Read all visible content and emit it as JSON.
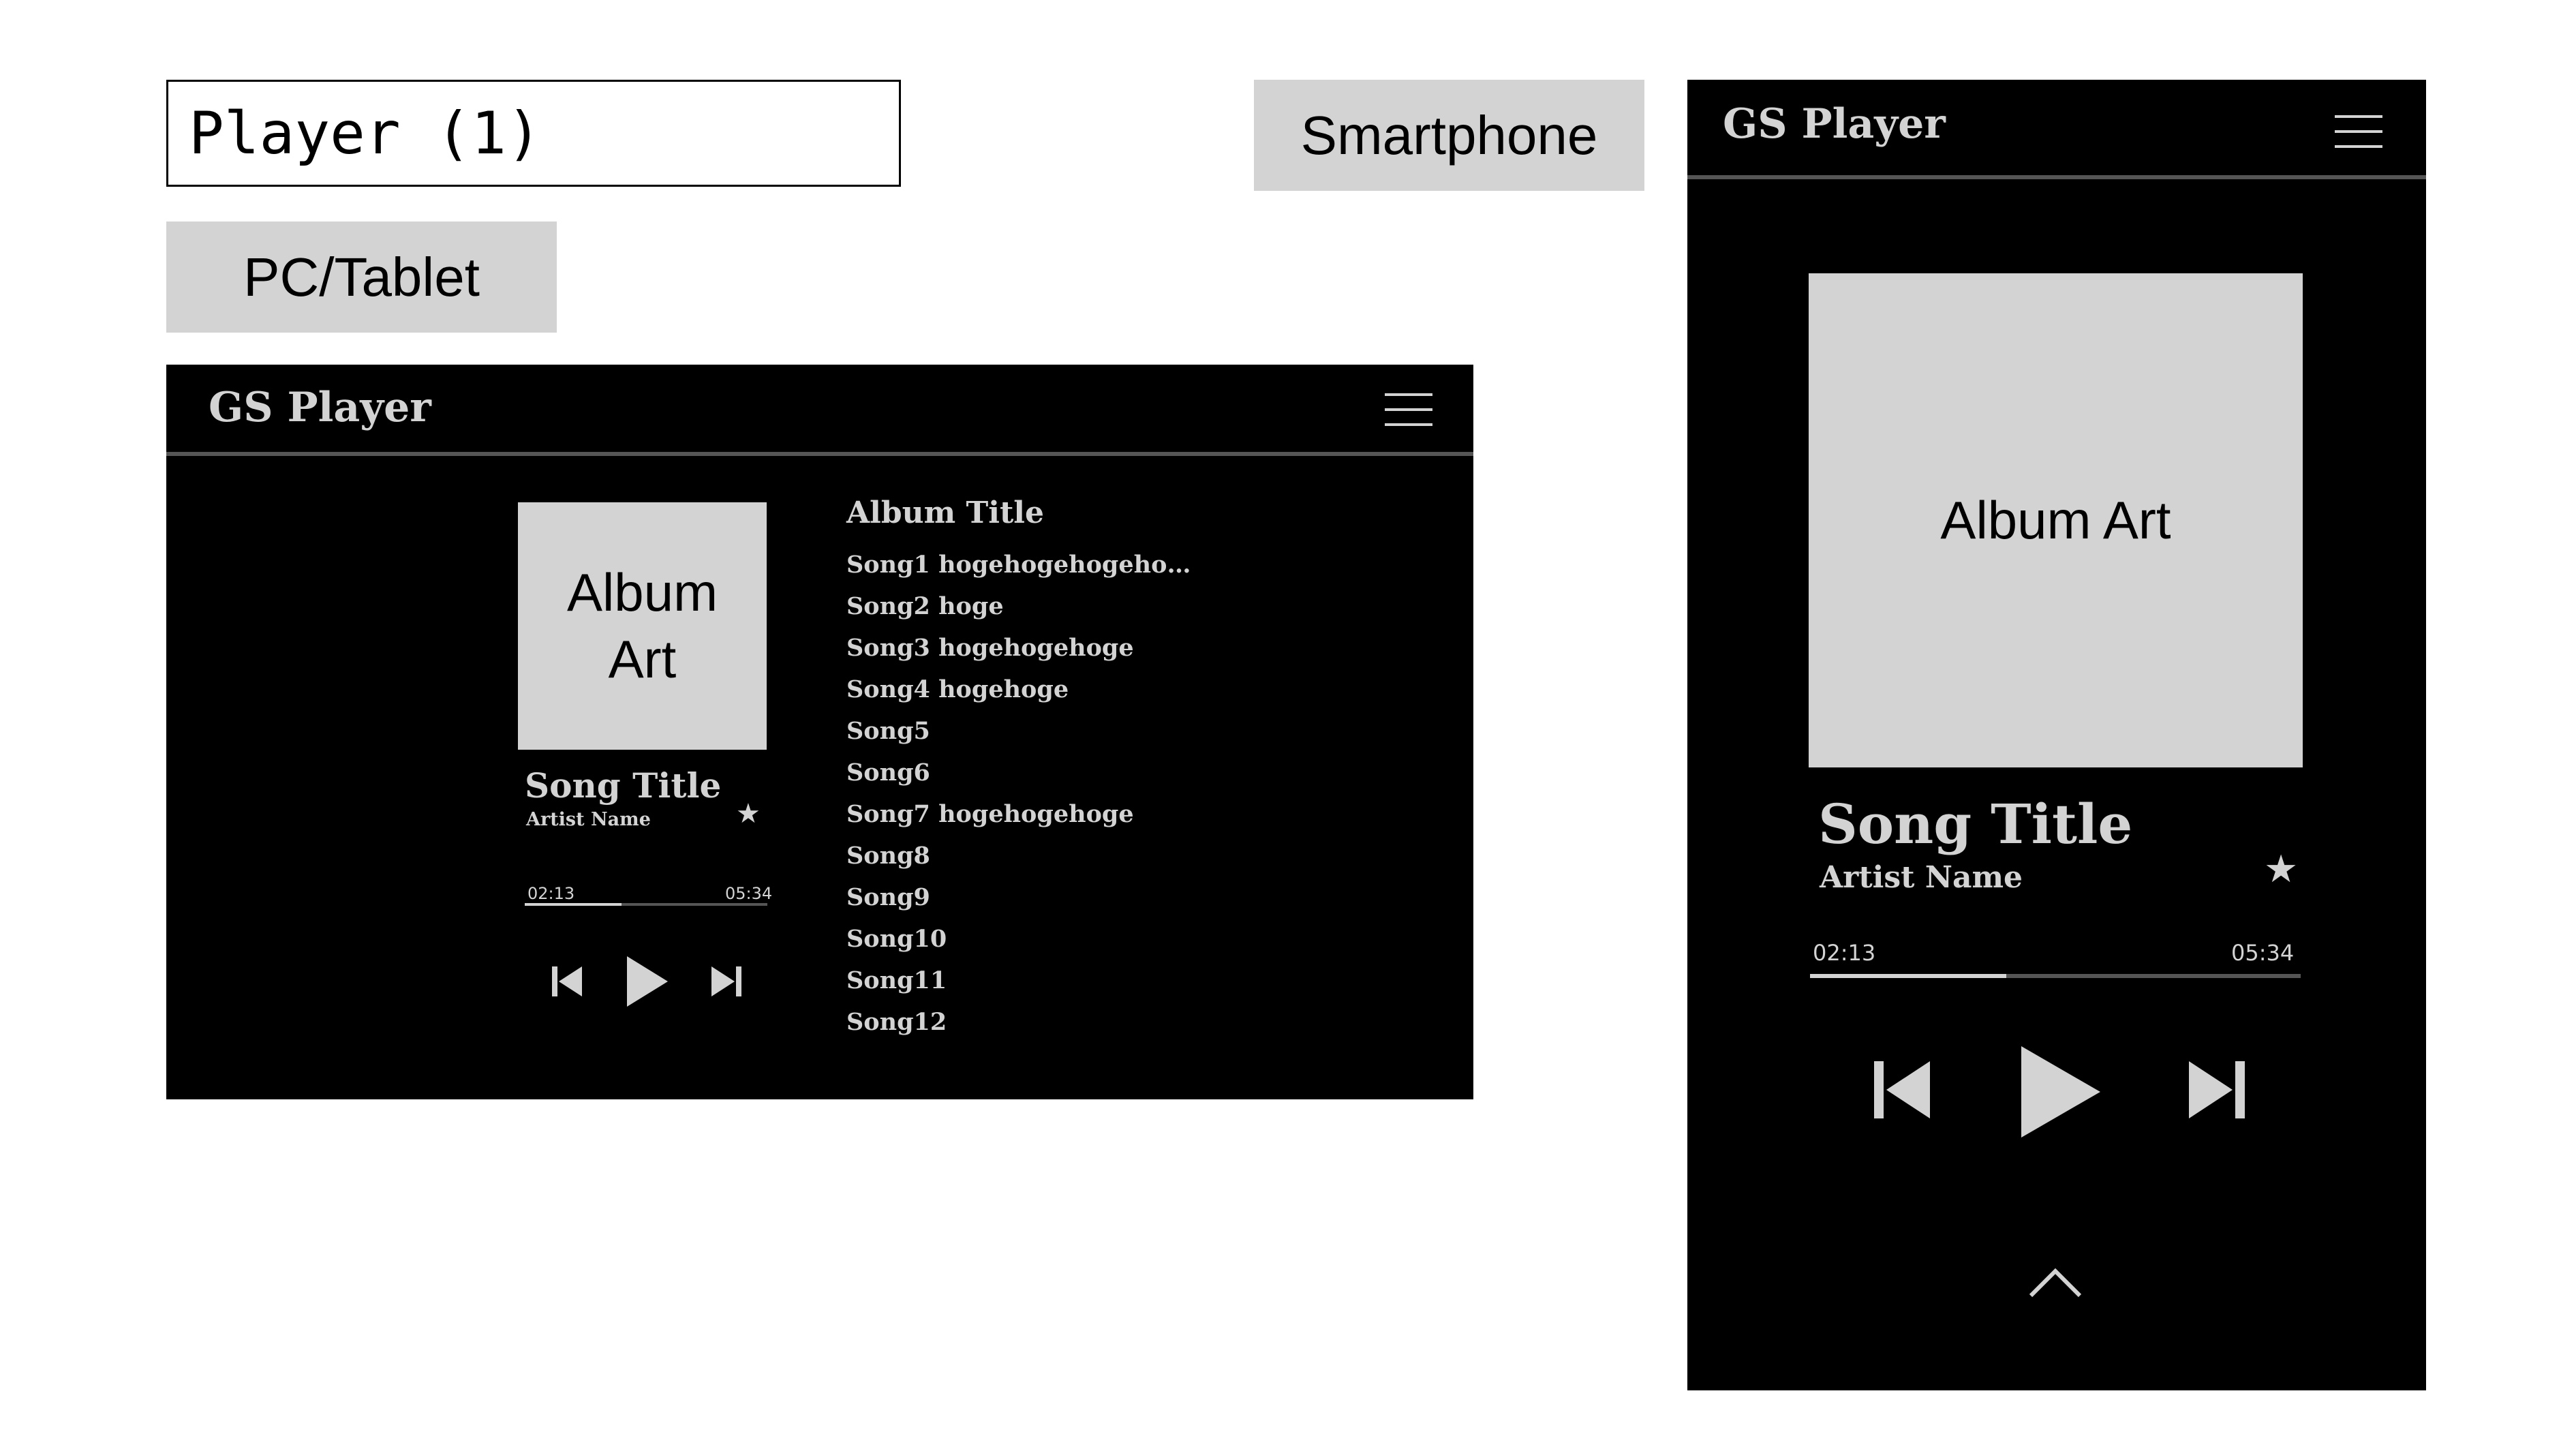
{
  "page": {
    "title": "Player (1)",
    "tag_pc": "PC/Tablet",
    "tag_smartphone": "Smartphone"
  },
  "pc": {
    "brand": "GS Player",
    "album_art_label": "Album Art",
    "song_title": "Song Title",
    "artist_name": "Artist Name",
    "time_current": "02:13",
    "time_total": "05:34",
    "progress_fraction": 0.4,
    "album_title": "Album Title",
    "songs": [
      "Song1 hogehogehogeho…",
      "Song2 hoge",
      "Song3 hogehogehoge",
      "Song4 hogehoge",
      "Song5",
      "Song6",
      "Song7 hogehogehoge",
      "Song8",
      "Song9",
      "Song10",
      "Song11",
      "Song12"
    ]
  },
  "smartphone": {
    "brand": "GS Player",
    "album_art_label": "Album Art",
    "song_title": "Song Title",
    "artist_name": "Artist Name",
    "time_current": "02:13",
    "time_total": "05:34",
    "progress_fraction": 0.4
  },
  "colors": {
    "frame_bg": "#000000",
    "foreground": "#d3d3d3",
    "tag_bg": "#d3d3d3"
  },
  "icons": {
    "menu": "hamburger-icon",
    "favorite": "star-icon",
    "previous": "skip-previous-icon",
    "play": "play-icon",
    "next": "skip-next-icon",
    "expand": "chevron-up-icon"
  }
}
